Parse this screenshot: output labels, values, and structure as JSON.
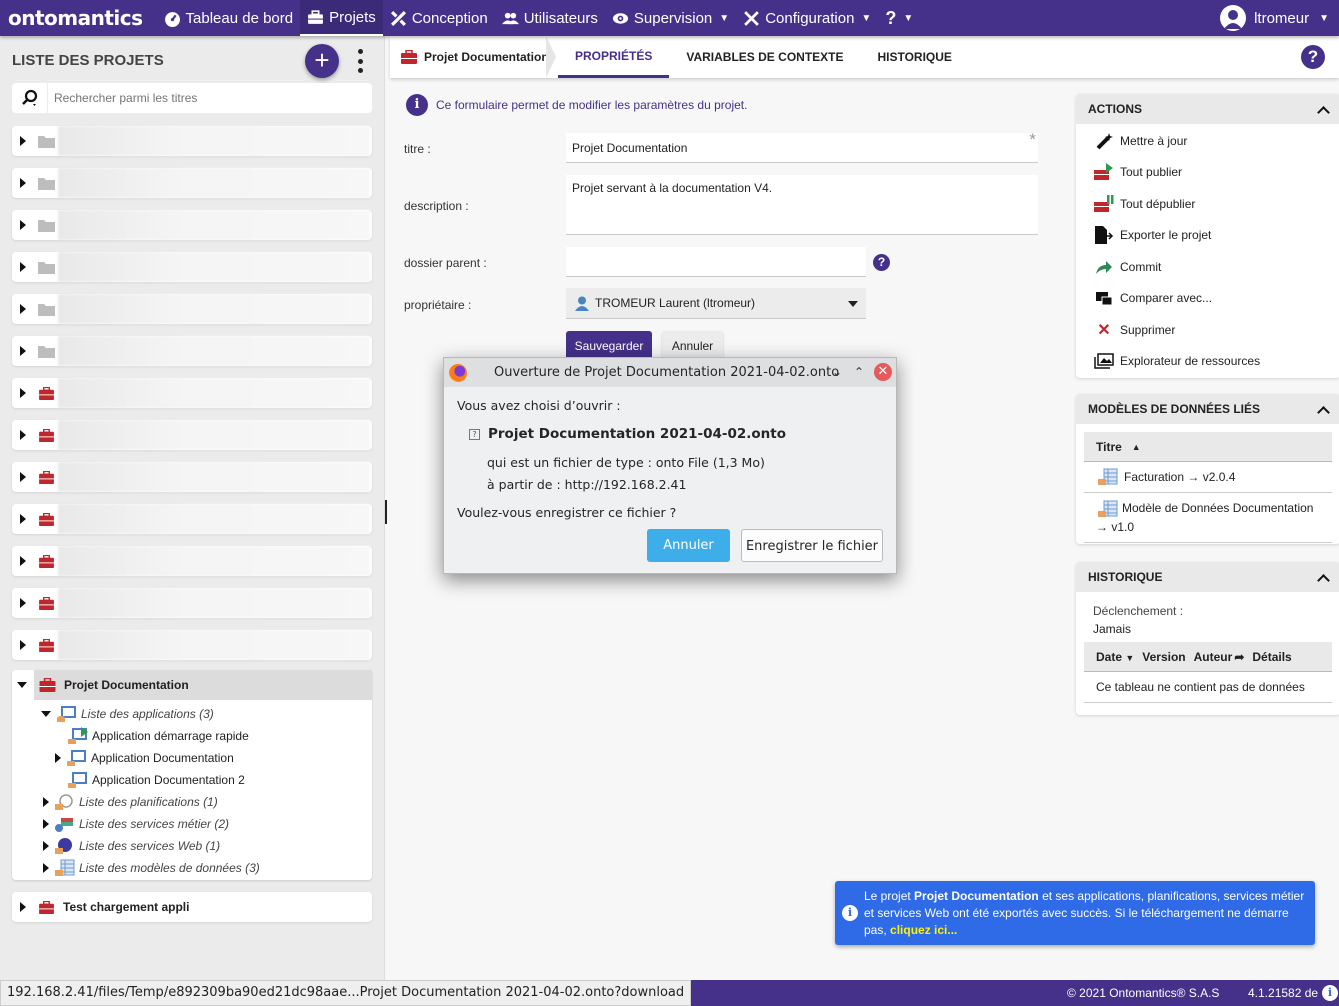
{
  "topbar": {
    "logo": "ontomantics",
    "nav": [
      {
        "label": "Tableau de bord",
        "icon": "dashboard-icon"
      },
      {
        "label": "Projets",
        "icon": "toolbox-icon",
        "active": true
      },
      {
        "label": "Conception",
        "icon": "tools-icon"
      },
      {
        "label": "Utilisateurs",
        "icon": "users-icon"
      },
      {
        "label": "Supervision",
        "icon": "eye-icon",
        "dropdown": true
      },
      {
        "label": "Configuration",
        "icon": "wrench-screwdriver-icon",
        "dropdown": true
      },
      {
        "label": "?",
        "icon": "help-icon",
        "dropdown": true
      }
    ],
    "user": "ltromeur"
  },
  "sidebar": {
    "title": "LISTE DES PROJETS",
    "add_label": "+",
    "search_placeholder": "Rechercher parmi les titres",
    "rows": [
      {
        "type": "folder",
        "label": "[blurred]"
      },
      {
        "type": "folder",
        "label": "[blurred]"
      },
      {
        "type": "folder",
        "label": "[blurred]"
      },
      {
        "type": "folder",
        "label": "[blurred]"
      },
      {
        "type": "folder",
        "label": "[blurred]"
      },
      {
        "type": "folder",
        "label": "[blurred]"
      },
      {
        "type": "project",
        "label": "[blurred]"
      },
      {
        "type": "project",
        "label": "[blurred]"
      },
      {
        "type": "project",
        "label": "[blurred]"
      },
      {
        "type": "project",
        "label": "[blurred]"
      },
      {
        "type": "project",
        "label": "[blurred]"
      },
      {
        "type": "project",
        "label": "[blurred]"
      },
      {
        "type": "project",
        "label": "[blurred]"
      }
    ],
    "expanded_project": {
      "label": "Projet Documentation",
      "children": [
        {
          "label": "Liste des applications (3)",
          "italic": true,
          "expanded": true
        },
        {
          "label": "Application démarrage rapide"
        },
        {
          "label": "Application Documentation"
        },
        {
          "label": "Application Documentation 2"
        },
        {
          "label": "Liste des planifications (1)",
          "italic": true
        },
        {
          "label": "Liste des services métier (2)",
          "italic": true
        },
        {
          "label": "Liste des services Web (1)",
          "italic": true
        },
        {
          "label": "Liste des modèles de données (3)",
          "italic": true
        }
      ]
    },
    "last_project": "Test chargement appli"
  },
  "main": {
    "breadcrumb": "Projet Documentation",
    "tabs": [
      "PROPRIÉTÉS",
      "VARIABLES DE CONTEXTE",
      "HISTORIQUE"
    ],
    "active_tab": "PROPRIÉTÉS",
    "info": "Ce formulaire permet de modifier les paramètres du projet.",
    "form": {
      "title_label": "titre :",
      "title_value": "Projet Documentation",
      "required_mark": "*",
      "description_label": "description :",
      "description_value": "Projet servant à la documentation V4.",
      "parent_label": "dossier parent :",
      "parent_value": "",
      "owner_label": "propriétaire :",
      "owner_value": "TROMEUR Laurent (ltromeur)",
      "save": "Sauvegarder",
      "cancel": "Annuler"
    }
  },
  "actions_panel": {
    "title": "ACTIONS",
    "items": [
      {
        "label": "Mettre à jour",
        "icon": "magic-wand-icon"
      },
      {
        "label": "Tout publier",
        "icon": "publish-all-icon"
      },
      {
        "label": "Tout dépublier",
        "icon": "unpublish-all-icon"
      },
      {
        "label": "Exporter le projet",
        "icon": "export-icon"
      },
      {
        "label": "Commit",
        "icon": "commit-arrow-icon"
      },
      {
        "label": "Comparer avec...",
        "icon": "compare-icon"
      },
      {
        "label": "Supprimer",
        "icon": "delete-x-icon"
      },
      {
        "label": "Explorateur de ressources",
        "icon": "images-icon"
      }
    ]
  },
  "models_panel": {
    "title": "MODÈLES DE DONNÉES LIÉS",
    "column": "Titre",
    "rows": [
      "Facturation → v2.0.4",
      "Modèle de Données Documentation → v1.0"
    ]
  },
  "history_panel": {
    "title": "HISTORIQUE",
    "trigger_label": "Déclenchement :",
    "trigger_value": "Jamais",
    "columns": [
      "Date",
      "Version",
      "Auteur",
      "Détails"
    ],
    "empty": "Ce tableau ne contient pas de données"
  },
  "dialog": {
    "title": "Ouverture de Projet Documentation 2021-04-02.onto",
    "intro": "Vous avez choisi d’ouvrir :",
    "filename": "Projet Documentation 2021-04-02.onto",
    "type_label": "qui est un fichier de type :",
    "type_value": "onto File (1,3 Mo)",
    "from_label": "à partir de :",
    "from_value": "http://192.168.2.41",
    "question": "Voulez-vous enregistrer ce fichier ?",
    "cancel": "Annuler",
    "save": "Enregistrer le fichier"
  },
  "toast": {
    "prefix": "Le projet ",
    "project": "Projet Documentation",
    "body": " et ses applications, planifications, services métier et services Web ont été exportés avec succès. Si le téléchargement ne démarre pas, ",
    "link": "cliquez ici..."
  },
  "footer": {
    "status_url": "192.168.2.41/files/Temp/e892309ba90ed21dc98aae...Projet Documentation 2021-04-02.onto?download",
    "copyright": "© 2021 Ontomantics® S.A.S",
    "version": "4.1.21582 de"
  },
  "colors": {
    "brand": "#45318a",
    "toast": "#2f6be6",
    "link_highlight": "#fff200",
    "project_red": "#c0272d",
    "dialog_primary": "#3daee9"
  }
}
